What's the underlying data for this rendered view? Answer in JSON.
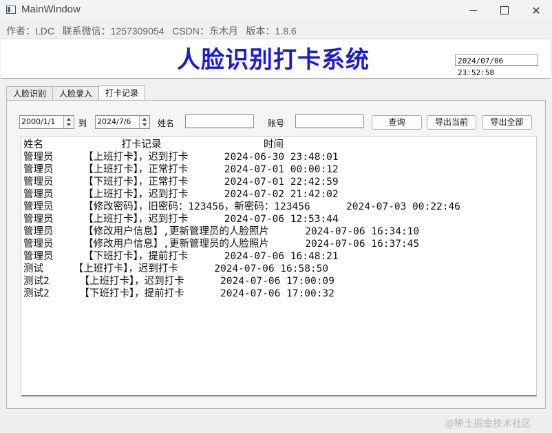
{
  "window": {
    "title": "MainWindow",
    "minimize_icon": "minimize-icon",
    "maximize_icon": "maximize-icon",
    "close_glyph": "✕"
  },
  "info_line": "作者：LDC   联系微信：1257309054   CSDN：东木月   版本：1.8.6",
  "header": {
    "title": "人脸识别打卡系统",
    "datetime": "2024/07/06 23:52:58"
  },
  "tabs": [
    {
      "label": "人脸识别"
    },
    {
      "label": "人脸录入"
    },
    {
      "label": "打卡记录",
      "active": true
    }
  ],
  "filters": {
    "start_date": "2000/1/1",
    "to_label": "到",
    "end_date": "2024/7/6",
    "name_label": "姓名",
    "name_value": "",
    "account_label": "账号",
    "account_value": "",
    "query_button": "查询",
    "export_current_button": "导出当前",
    "export_all_button": "导出全部"
  },
  "records": {
    "header": "姓名             打卡记录                 时间",
    "rows": [
      "管理员     【上班打卡】，迟到打卡      2024-06-30 23:48:01",
      "管理员     【上班打卡】，正常打卡      2024-07-01 00:00:12",
      "管理员     【下班打卡】，正常打卡      2024-07-01 22:42:59",
      "管理员     【上班打卡】，迟到打卡      2024-07-02 21:42:02",
      "管理员     【修改密码】，旧密码：123456，新密码：123456      2024-07-03 00:22:46",
      "管理员     【上班打卡】，迟到打卡      2024-07-06 12:53:44",
      "管理员     【修改用户信息】,更新管理员的人脸照片      2024-07-06 16:34:10",
      "管理员     【修改用户信息】,更新管理员的人脸照片      2024-07-06 16:37:45",
      "管理员     【下班打卡】，提前打卡      2024-07-06 16:48:21",
      "测试     【上班打卡】，迟到打卡      2024-07-06 16:58:50",
      "测试2     【上班打卡】，迟到打卡      2024-07-06 17:00:09",
      "测试2     【下班打卡】，提前打卡      2024-07-06 17:00:32"
    ]
  },
  "watermark": "@稀土掘金技术社区"
}
